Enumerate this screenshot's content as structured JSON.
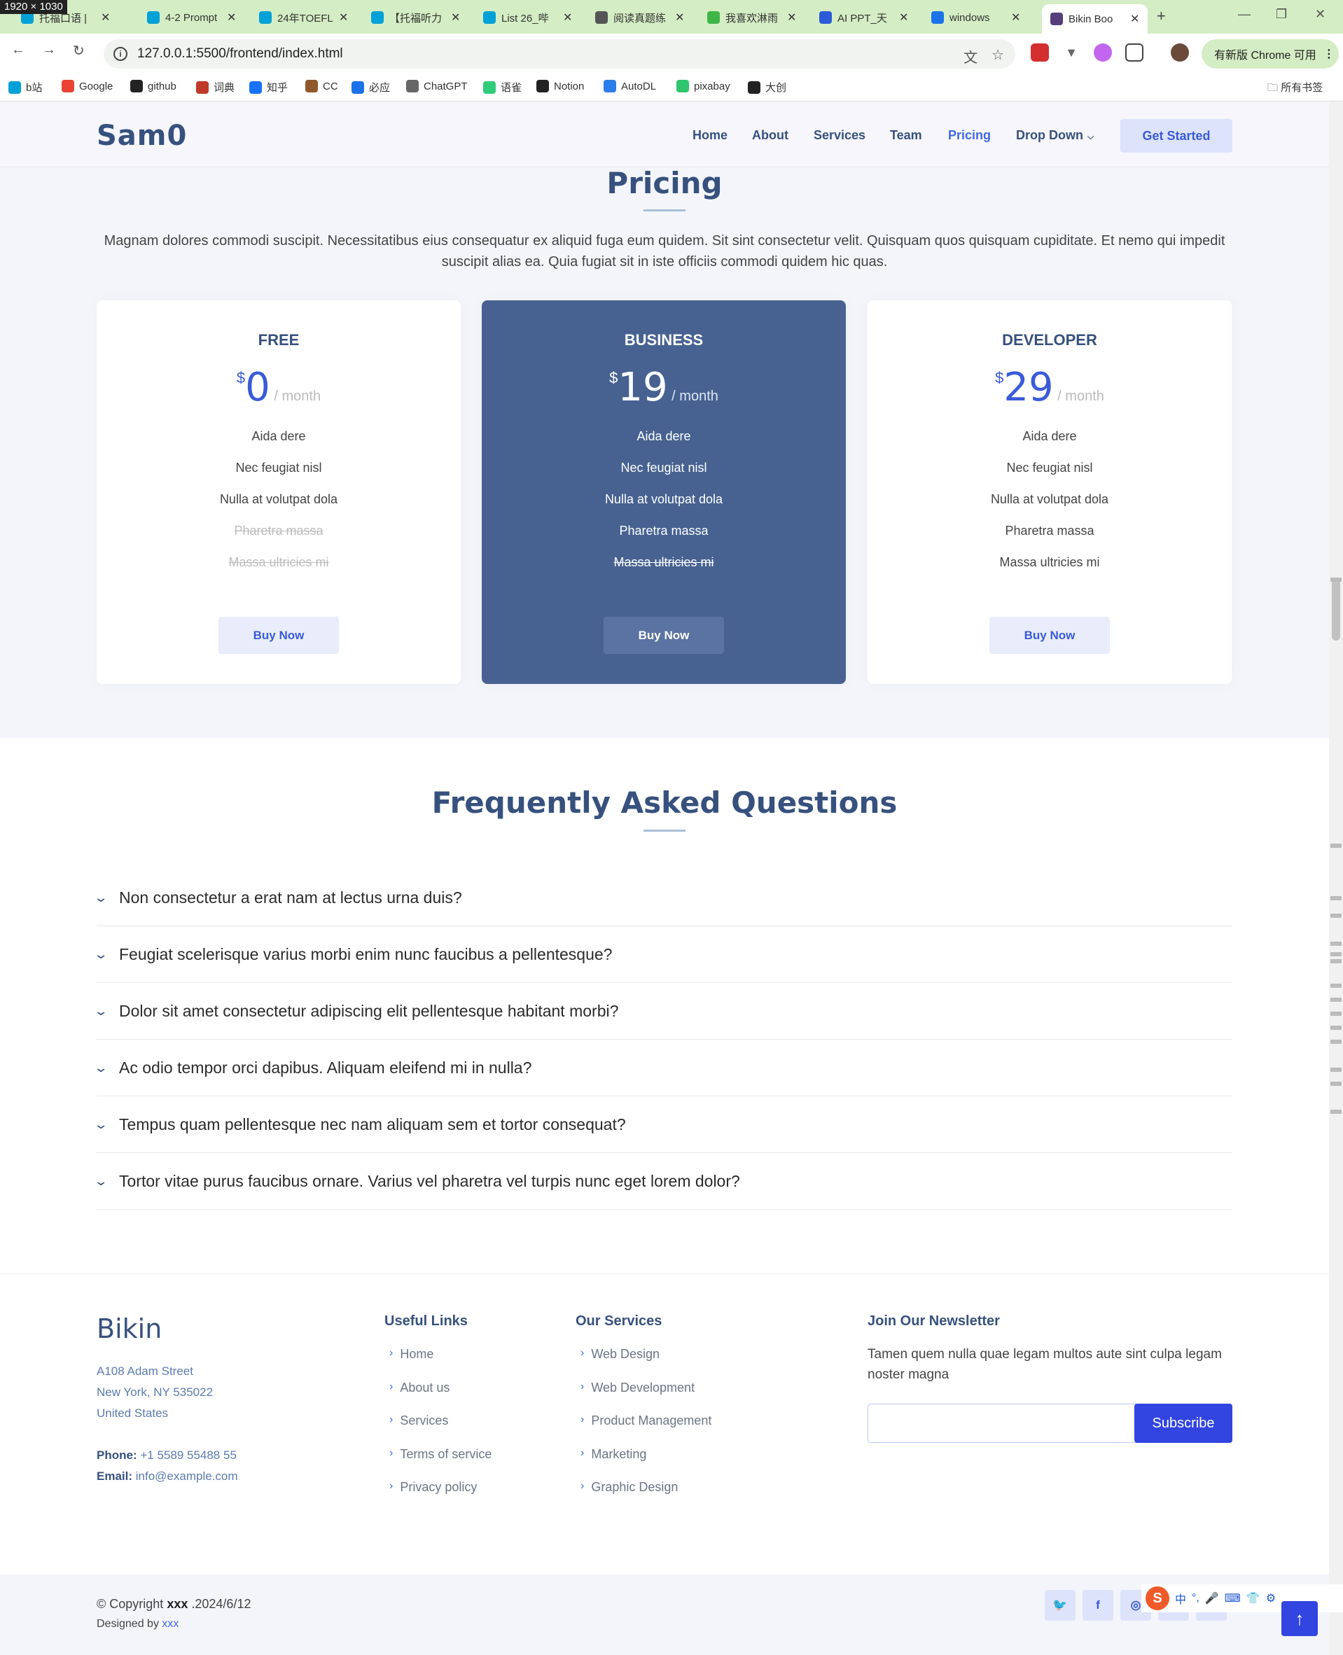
{
  "browser": {
    "size_badge": "1920 × 1030",
    "tabs": [
      {
        "label": "托福口语 |",
        "color": "#00a1d6"
      },
      {
        "label": "4-2 Prompt",
        "color": "#00a1d6"
      },
      {
        "label": "24年TOEFL",
        "color": "#00a1d6"
      },
      {
        "label": "【托福听力",
        "color": "#00a1d6"
      },
      {
        "label": "List 26_哔",
        "color": "#00a1d6"
      },
      {
        "label": "阅读真题练",
        "color": "#555555"
      },
      {
        "label": "我喜欢淋雨",
        "color": "#3fb548"
      },
      {
        "label": "AI PPT_天",
        "color": "#2b5bd7"
      },
      {
        "label": "windows",
        "color": "#1a73e8"
      },
      {
        "label": "Bikin Boo",
        "color": "#563d7c"
      }
    ],
    "url": "127.0.0.1:5500/frontend/index.html",
    "update_label": "有新版 Chrome 可用",
    "bookmarks": [
      {
        "label": "b站",
        "color": "#00a1d6"
      },
      {
        "label": "Google",
        "color": "#ea4335"
      },
      {
        "label": "github",
        "color": "#222222"
      },
      {
        "label": "词典",
        "color": "#c0392b"
      },
      {
        "label": "知乎",
        "color": "#1772f6"
      },
      {
        "label": "CC",
        "color": "#8e5a2b"
      },
      {
        "label": "必应",
        "color": "#1a73e8"
      },
      {
        "label": "ChatGPT",
        "color": "#666666"
      },
      {
        "label": "语雀",
        "color": "#31cc79"
      },
      {
        "label": "Notion",
        "color": "#222222"
      },
      {
        "label": "AutoDL",
        "color": "#2b7de9"
      },
      {
        "label": "pixabay",
        "color": "#2ec66d"
      },
      {
        "label": "大创",
        "color": "#222222"
      }
    ],
    "all_bookmarks": "所有书签"
  },
  "header": {
    "logo": "Sam0",
    "nav": [
      "Home",
      "About",
      "Services",
      "Team",
      "Pricing",
      "Drop Down"
    ],
    "active_nav": "Pricing",
    "cta": "Get Started"
  },
  "pricing": {
    "title": "Pricing",
    "description": "Magnam dolores commodi suscipit. Necessitatibus eius consequatur ex aliquid fuga eum quidem. Sit sint consectetur velit. Quisquam quos quisquam cupiditate. Et nemo qui impedit suscipit alias ea. Quia fugiat sit in iste officiis commodi quidem hic quas.",
    "plans": [
      {
        "name": "FREE",
        "currency": "$",
        "amount": "0",
        "period": " / month",
        "features": [
          "Aida dere",
          "Nec feugiat nisl",
          "Nulla at volutpat dola",
          "Pharetra massa",
          "Massa ultricies mi"
        ],
        "unavailable_from": 3,
        "button": "Buy Now"
      },
      {
        "name": "BUSINESS",
        "currency": "$",
        "amount": "19",
        "period": " / month",
        "features": [
          "Aida dere",
          "Nec feugiat nisl",
          "Nulla at volutpat dola",
          "Pharetra massa",
          "Massa ultricies mi"
        ],
        "unavailable_from": 4,
        "button": "Buy Now"
      },
      {
        "name": "DEVELOPER",
        "currency": "$",
        "amount": "29",
        "period": " / month",
        "features": [
          "Aida dere",
          "Nec feugiat nisl",
          "Nulla at volutpat dola",
          "Pharetra massa",
          "Massa ultricies mi"
        ],
        "unavailable_from": 5,
        "button": "Buy Now"
      }
    ]
  },
  "faq": {
    "title": "Frequently Asked Questions",
    "questions": [
      "Non consectetur a erat nam at lectus urna duis?",
      "Feugiat scelerisque varius morbi enim nunc faucibus a pellentesque?",
      "Dolor sit amet consectetur adipiscing elit pellentesque habitant morbi?",
      "Ac odio tempor orci dapibus. Aliquam eleifend mi in nulla?",
      "Tempus quam pellentesque nec nam aliquam sem et tortor consequat?",
      "Tortor vitae purus faucibus ornare. Varius vel pharetra vel turpis nunc eget lorem dolor?"
    ]
  },
  "footer": {
    "brand": "Bikin",
    "address": [
      "A108 Adam Street",
      "New York, NY 535022",
      "United States"
    ],
    "phone_label": "Phone:",
    "phone": "+1 5589 55488 55",
    "email_label": "Email:",
    "email": "info@example.com",
    "useful_links_title": "Useful Links",
    "useful_links": [
      "Home",
      "About us",
      "Services",
      "Terms of service",
      "Privacy policy"
    ],
    "services_title": "Our Services",
    "services": [
      "Web Design",
      "Web Development",
      "Product Management",
      "Marketing",
      "Graphic Design"
    ],
    "newsletter_title": "Join Our Newsletter",
    "newsletter_text": "Tamen quem nulla quae legam multos aute sint culpa legam noster magna",
    "subscribe": "Subscribe"
  },
  "copyright": {
    "prefix": "© Copyright",
    "owner": "xxx",
    "date": ".2024/6/12",
    "designed_prefix": "Designed by",
    "designer": "xxx"
  },
  "social": [
    "twitter-icon",
    "facebook-icon",
    "instagram-icon",
    "skype-icon",
    "linkedin-icon"
  ],
  "ime": {
    "lang": "中"
  }
}
